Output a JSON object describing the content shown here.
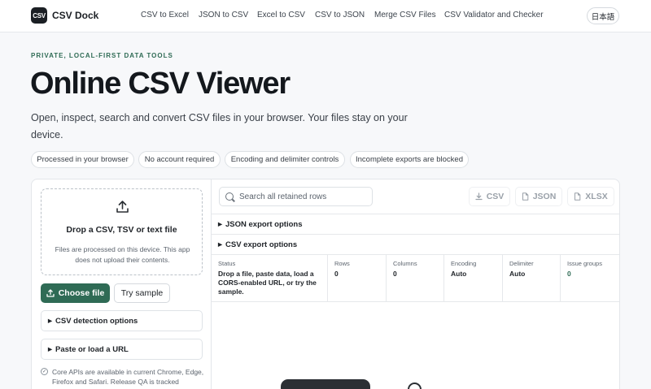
{
  "header": {
    "logo_text": "CSV",
    "brand": "CSV Dock",
    "nav": [
      "CSV to Excel",
      "JSON to CSV",
      "Excel to CSV",
      "CSV to JSON",
      "Merge CSV Files",
      "CSV Validator and Checker"
    ],
    "language": "日本語"
  },
  "hero": {
    "eyebrow": "PRIVATE, LOCAL-FIRST DATA TOOLS",
    "title": "Online CSV Viewer",
    "subtitle": "Open, inspect, search and convert CSV files in your browser. Your files stay on your device.",
    "pills": [
      "Processed in your browser",
      "No account required",
      "Encoding and delimiter controls",
      "Incomplete exports are blocked"
    ]
  },
  "upload": {
    "drop_title": "Drop a CSV, TSV or text file",
    "drop_desc": "Files are processed on this device. This app does not upload their contents.",
    "choose_file": "Choose file",
    "try_sample": "Try sample",
    "detection_options": "CSV detection options",
    "paste_url": "Paste or load a URL",
    "note": "Core APIs are available in current Chrome, Edge, Firefox and Safari. Release QA is tracked"
  },
  "viewer": {
    "search_placeholder": "Search all retained rows",
    "export_buttons": [
      "CSV",
      "JSON",
      "XLSX"
    ],
    "json_options": "JSON export options",
    "csv_options": "CSV export options",
    "stats": {
      "status_label": "Status",
      "status_value": "Drop a file, paste data, load a CORS-enabled URL, or try the sample.",
      "rows_label": "Rows",
      "rows_value": "0",
      "columns_label": "Columns",
      "columns_value": "0",
      "encoding_label": "Encoding",
      "encoding_value": "Auto",
      "delimiter_label": "Delimiter",
      "delimiter_value": "Auto",
      "issues_label": "Issue groups",
      "issues_value": "0"
    }
  },
  "colors": {
    "accent": "#2f6b55",
    "text": "#1f2328",
    "muted": "#5b636d"
  }
}
